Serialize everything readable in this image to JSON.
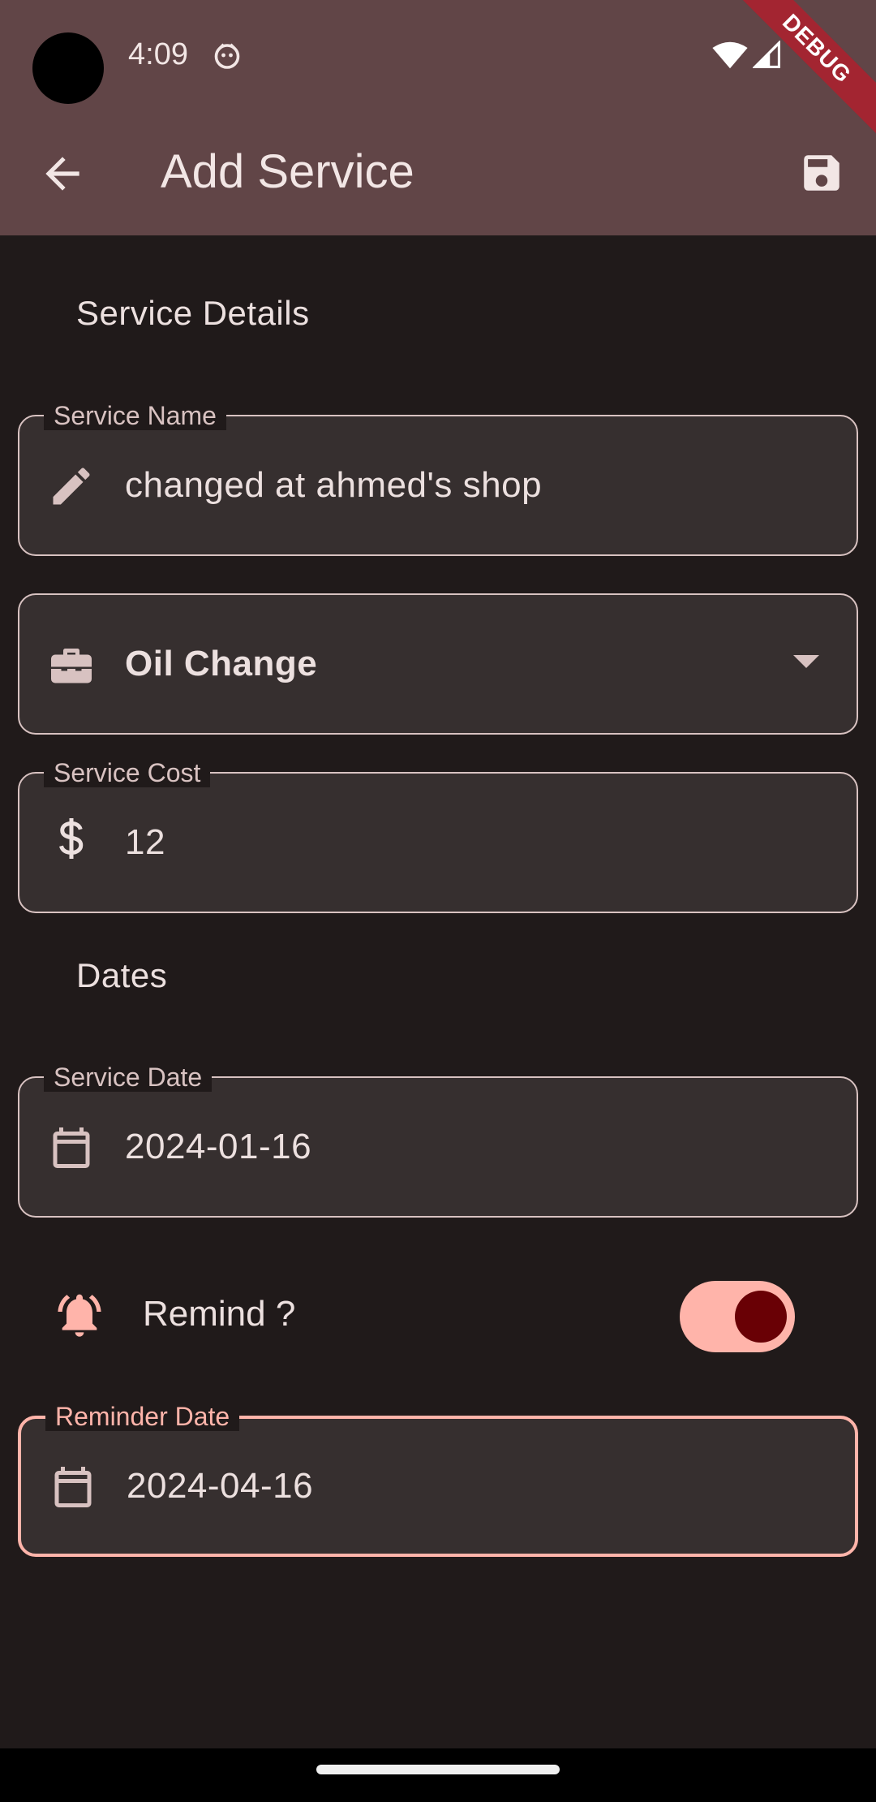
{
  "status_bar": {
    "time": "4:09"
  },
  "debug_banner": "DEBUG",
  "app_bar": {
    "title": "Add Service"
  },
  "sections": {
    "service_details": "Service Details",
    "dates": "Dates"
  },
  "fields": {
    "service_name": {
      "label": "Service Name",
      "value": "changed at ahmed's shop",
      "icon": "pencil-icon"
    },
    "service_type": {
      "value": "Oil Change",
      "icon": "toolbox-icon"
    },
    "service_cost": {
      "label": "Service Cost",
      "value": "12",
      "icon": "dollar-icon"
    },
    "service_date": {
      "label": "Service Date",
      "value": "2024-01-16",
      "icon": "calendar-icon"
    },
    "reminder_date": {
      "label": "Reminder Date",
      "value": "2024-04-16",
      "icon": "calendar-icon"
    }
  },
  "remind": {
    "label": "Remind ?",
    "enabled": true
  },
  "colors": {
    "app_bar": "#614547",
    "background": "#201a1a",
    "field_fill": "#362f2f",
    "accent": "#ffb4aa",
    "toggle_knob": "#690005"
  }
}
